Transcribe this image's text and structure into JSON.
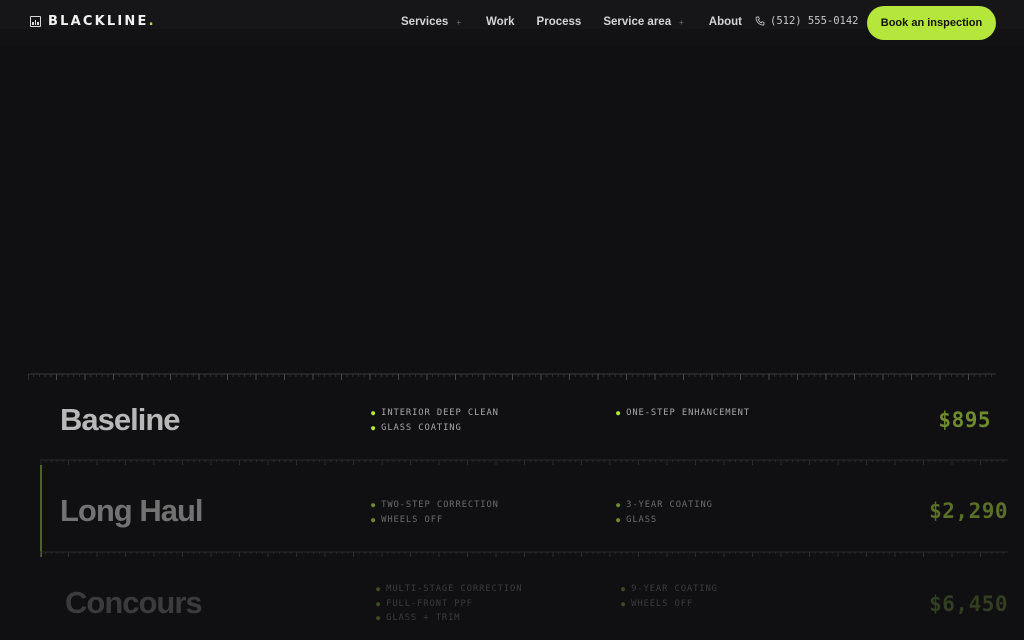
{
  "header": {
    "brand": {
      "name": "BLACKLINE",
      "dot": "."
    },
    "nav": [
      {
        "label": "Services",
        "has_submenu": true
      },
      {
        "label": "Work",
        "has_submenu": false
      },
      {
        "label": "Process",
        "has_submenu": false
      },
      {
        "label": "Service area",
        "has_submenu": true
      },
      {
        "label": "About",
        "has_submenu": false
      }
    ],
    "submenu_glyph": "+",
    "phone": "(512) 555-0142",
    "cta_label": "Book an inspection"
  },
  "packages": [
    {
      "name": "Baseline",
      "features_col1": [
        "INTERIOR DEEP CLEAN",
        "GLASS COATING"
      ],
      "features_col2": [
        "ONE-STEP ENHANCEMENT"
      ],
      "price": "$895"
    },
    {
      "name": "Long Haul",
      "features_col1": [
        "TWO-STEP CORRECTION",
        "WHEELS OFF"
      ],
      "features_col2": [
        "3-YEAR COATING",
        "GLASS"
      ],
      "price": "$2,290"
    },
    {
      "name": "Concours",
      "features_col1": [
        "MULTI-STAGE CORRECTION",
        "FULL-FRONT PPF",
        "GLASS + TRIM"
      ],
      "features_col2": [
        "9-YEAR COATING",
        "WHEELS OFF"
      ],
      "price": "$6,450"
    }
  ],
  "colors": {
    "accent": "#b5e63b",
    "background": "#101012",
    "header": "#161618"
  },
  "bullet_glyph": "●"
}
